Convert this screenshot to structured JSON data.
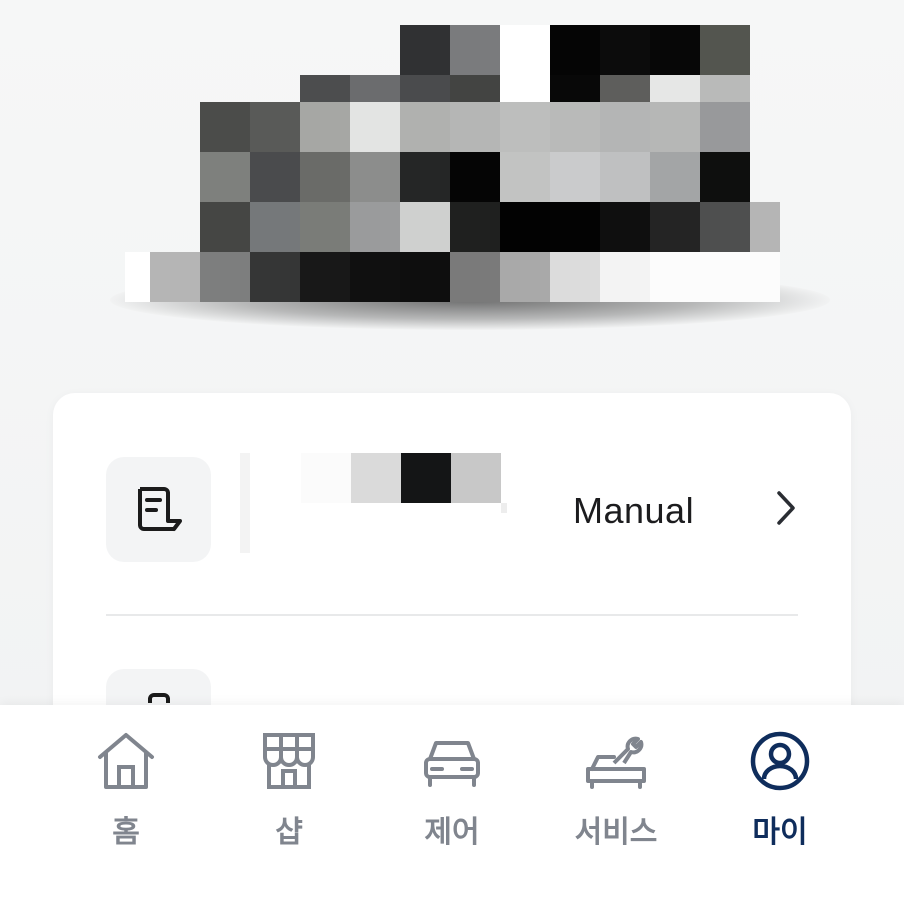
{
  "vehicle": {
    "image_redacted": true
  },
  "menu": {
    "items": [
      {
        "icon": "manual-icon",
        "label": "Manual"
      }
    ]
  },
  "bottom_nav": {
    "active": "my",
    "items": [
      {
        "id": "home",
        "icon": "home-icon",
        "label": "홈"
      },
      {
        "id": "shop",
        "icon": "shop-icon",
        "label": "샵"
      },
      {
        "id": "control",
        "icon": "car-icon",
        "label": "제어"
      },
      {
        "id": "service",
        "icon": "service-icon",
        "label": "서비스"
      },
      {
        "id": "my",
        "icon": "profile-icon",
        "label": "마이"
      }
    ]
  },
  "colors": {
    "background": "#f4f5f6",
    "card": "#ffffff",
    "icon_box": "#f3f4f5",
    "nav_inactive": "#80858e",
    "nav_active": "#0f2d5c",
    "text_primary": "#1c1c1e"
  }
}
